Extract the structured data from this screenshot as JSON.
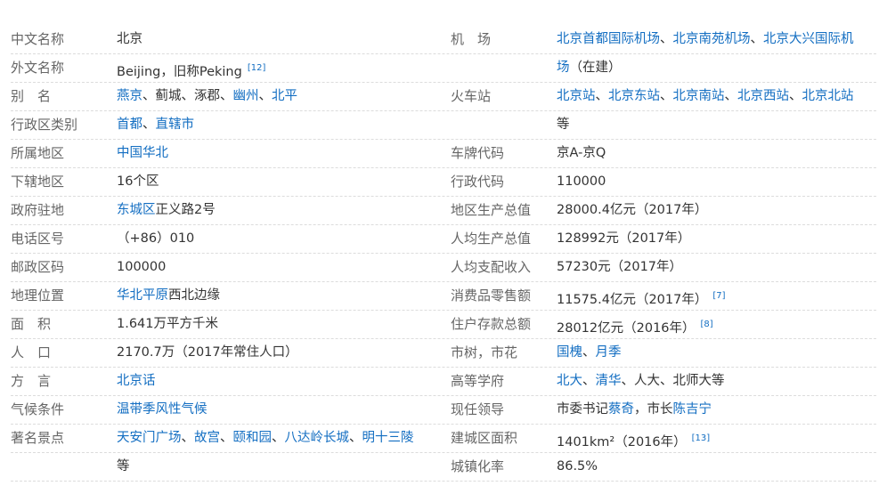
{
  "rows": [
    {
      "l1": "中文名称",
      "v1": [
        {
          "t": "北京"
        }
      ],
      "l2": "机　场",
      "v2": [
        {
          "t": "北京首都国际机场",
          "link": true
        },
        {
          "t": "、"
        },
        {
          "t": "北京南苑机场",
          "link": true
        },
        {
          "t": "、"
        },
        {
          "t": "北京大兴国际机",
          "link": true
        }
      ]
    },
    {
      "l1": "外文名称",
      "v1": [
        {
          "t": "Beijing，旧称Peking"
        },
        {
          "t": "[12]",
          "sup": true
        }
      ],
      "l2": "",
      "v2": [
        {
          "t": "场",
          "link": true
        },
        {
          "t": "（在建）"
        }
      ]
    },
    {
      "l1": "别　名",
      "v1": [
        {
          "t": "燕京",
          "link": true
        },
        {
          "t": "、蓟城、涿郡、"
        },
        {
          "t": "幽州",
          "link": true
        },
        {
          "t": "、"
        },
        {
          "t": "北平",
          "link": true
        }
      ],
      "l2": "火车站",
      "v2": [
        {
          "t": "北京站",
          "link": true
        },
        {
          "t": "、"
        },
        {
          "t": "北京东站",
          "link": true
        },
        {
          "t": "、"
        },
        {
          "t": "北京南站",
          "link": true
        },
        {
          "t": "、"
        },
        {
          "t": "北京西站",
          "link": true
        },
        {
          "t": "、"
        },
        {
          "t": "北京北站",
          "link": true
        }
      ]
    },
    {
      "l1": "行政区类别",
      "v1": [
        {
          "t": "首都",
          "link": true
        },
        {
          "t": "、"
        },
        {
          "t": "直辖市",
          "link": true
        }
      ],
      "l2": "",
      "v2": [
        {
          "t": "等"
        }
      ]
    },
    {
      "l1": "所属地区",
      "v1": [
        {
          "t": "中国",
          "link": true
        },
        {
          "t": "华北",
          "link": true
        }
      ],
      "l2": "车牌代码",
      "v2": [
        {
          "t": "京A-京Q"
        }
      ]
    },
    {
      "l1": "下辖地区",
      "v1": [
        {
          "t": "16个区"
        }
      ],
      "l2": "行政代码",
      "v2": [
        {
          "t": "110000"
        }
      ]
    },
    {
      "l1": "政府驻地",
      "v1": [
        {
          "t": "东城区",
          "link": true
        },
        {
          "t": "正义路2号"
        }
      ],
      "l2": "地区生产总值",
      "v2": [
        {
          "t": "28000.4亿元（2017年）"
        }
      ]
    },
    {
      "l1": "电话区号",
      "v1": [
        {
          "t": "（+86）010"
        }
      ],
      "l2": "人均生产总值",
      "v2": [
        {
          "t": "128992元（2017年）"
        }
      ]
    },
    {
      "l1": "邮政区码",
      "v1": [
        {
          "t": "100000"
        }
      ],
      "l2": "人均支配收入",
      "v2": [
        {
          "t": "57230元（2017年）"
        }
      ]
    },
    {
      "l1": "地理位置",
      "v1": [
        {
          "t": "华北平原",
          "link": true
        },
        {
          "t": "西北边缘"
        }
      ],
      "l2": "消费品零售额",
      "v2": [
        {
          "t": "11575.4亿元（2017年）"
        },
        {
          "t": "[7]",
          "sup": true
        }
      ]
    },
    {
      "l1": "面　积",
      "v1": [
        {
          "t": "1.641万平方千米"
        }
      ],
      "l2": "住户存款总额",
      "v2": [
        {
          "t": "28012亿元（2016年）"
        },
        {
          "t": "[8]",
          "sup": true
        }
      ]
    },
    {
      "l1": "人　口",
      "v1": [
        {
          "t": "2170.7万（2017年常住人口）"
        }
      ],
      "l2": "市树，市花",
      "v2": [
        {
          "t": "国槐",
          "link": true
        },
        {
          "t": "、"
        },
        {
          "t": "月季",
          "link": true
        }
      ]
    },
    {
      "l1": "方　言",
      "v1": [
        {
          "t": "北京话",
          "link": true
        }
      ],
      "l2": "高等学府",
      "v2": [
        {
          "t": "北大",
          "link": true
        },
        {
          "t": "、"
        },
        {
          "t": "清华",
          "link": true
        },
        {
          "t": "、人大、北师大等"
        }
      ]
    },
    {
      "l1": "气候条件",
      "v1": [
        {
          "t": "温带季风性气候",
          "link": true
        }
      ],
      "l2": "现任领导",
      "v2": [
        {
          "t": "市委书记"
        },
        {
          "t": "蔡奇",
          "link": true
        },
        {
          "t": "，市长"
        },
        {
          "t": "陈吉宁",
          "link": true
        }
      ]
    },
    {
      "l1": "著名景点",
      "v1": [
        {
          "t": "天安门广场",
          "link": true
        },
        {
          "t": "、"
        },
        {
          "t": "故宫",
          "link": true
        },
        {
          "t": "、"
        },
        {
          "t": "颐和园",
          "link": true
        },
        {
          "t": "、"
        },
        {
          "t": "八达岭长城",
          "link": true
        },
        {
          "t": "、"
        },
        {
          "t": "明十三陵",
          "link": true
        }
      ],
      "l2": "建城区面积",
      "v2": [
        {
          "t": "1401km²（2016年）"
        },
        {
          "t": "[13]",
          "sup": true
        }
      ]
    },
    {
      "l1": "",
      "v1": [
        {
          "t": "等"
        }
      ],
      "l2": "城镇化率",
      "v2": [
        {
          "t": "86.5%"
        }
      ]
    }
  ]
}
